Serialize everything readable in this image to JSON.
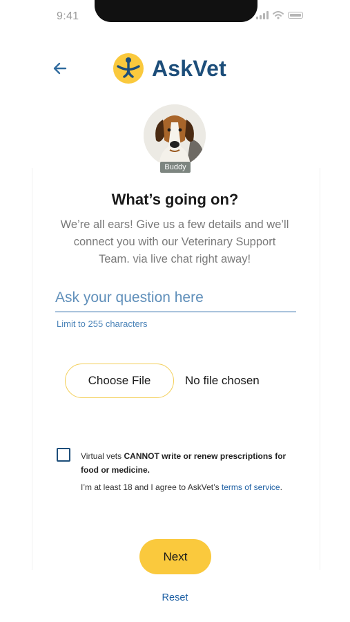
{
  "status_bar": {
    "time": "9:41"
  },
  "header": {
    "brand": "AskVet"
  },
  "pet": {
    "name": "Buddy"
  },
  "form": {
    "title": "What’s going on?",
    "subtitle": "We’re all ears! Give us a few details and we’ll connect you with our Veterinary Support Team. via live chat right away!",
    "question_placeholder": "Ask your question here",
    "question_value": "",
    "limit_hint": "Limit to 255 characters",
    "choose_file_label": "Choose File",
    "file_status": "No file chosen",
    "disclaimer_prefix": "Virtual vets ",
    "disclaimer_bold": "CANNOT write or renew prescriptions for food or medicine.",
    "agree_prefix": "I’m at least 18 and I agree to AskVet’s ",
    "terms_link": "terms of service",
    "agree_suffix": ".",
    "terms_checked": false
  },
  "actions": {
    "next_label": "Next",
    "reset_label": "Reset"
  },
  "colors": {
    "brand_navy": "#1d4e7a",
    "accent_yellow": "#fac93d",
    "link_blue": "#1d5fa3"
  }
}
